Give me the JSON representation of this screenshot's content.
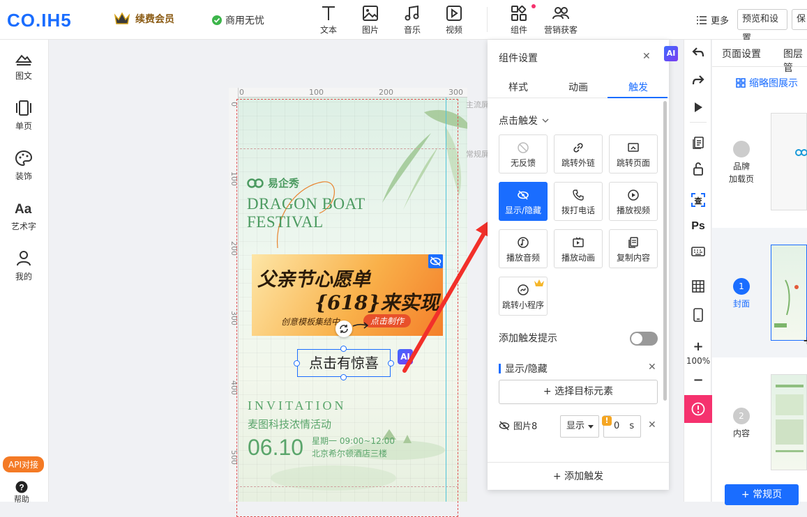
{
  "topbar": {
    "logo": "CO.IH5",
    "vip_label": "续费会员",
    "commerce_label": "商用无忧",
    "tools": [
      {
        "label": "文本",
        "icon": "text-icon"
      },
      {
        "label": "图片",
        "icon": "image-icon"
      },
      {
        "label": "音乐",
        "icon": "music-icon"
      },
      {
        "label": "视频",
        "icon": "video-icon"
      },
      {
        "label": "组件",
        "icon": "component-icon"
      },
      {
        "label": "营销获客",
        "icon": "users-icon"
      }
    ],
    "more": "更多",
    "preview": "预览和设置",
    "save": "保"
  },
  "sidebar": {
    "items": [
      {
        "label": "图文",
        "icon": "image-text-icon"
      },
      {
        "label": "单页",
        "icon": "single-page-icon"
      },
      {
        "label": "装饰",
        "icon": "palette-icon"
      },
      {
        "label": "艺术字",
        "icon": "art-text-icon"
      },
      {
        "label": "我的",
        "icon": "user-icon"
      }
    ],
    "api_label": "API对接",
    "help_label": "帮助"
  },
  "canvas": {
    "ruler_h": [
      "0",
      "100",
      "200",
      "300"
    ],
    "ruler_v": [
      "0",
      "100",
      "200",
      "300",
      "400",
      "500"
    ],
    "side_labels": [
      "主流屏",
      "常规屏"
    ],
    "brand": "易企秀",
    "dragon_line1": "DRAGON BOAT",
    "dragon_line2": "FESTIVAL",
    "banner_line1": "父亲节心愿单",
    "banner_line2": "{618}来实现",
    "banner_sub": "创意模板集结中",
    "banner_btn": "点击制作",
    "selected_text": "点击有惊喜",
    "ai_badge": "AI",
    "invitation": "INVITATION",
    "event": "麦图科技浓情活动",
    "date": "06.10",
    "time": "星期一  09:00~12:00",
    "venue": "北京希尔顿酒店三楼"
  },
  "panel": {
    "title": "组件设置",
    "tabs": [
      {
        "label": "样式"
      },
      {
        "label": "动画"
      },
      {
        "label": "触发"
      }
    ],
    "active_tab": "触发",
    "click_trigger": "点击触发",
    "actions": [
      {
        "label": "无反馈",
        "icon": "ban-icon"
      },
      {
        "label": "跳转外链",
        "icon": "link-icon"
      },
      {
        "label": "跳转页面",
        "icon": "page-jump-icon"
      },
      {
        "label": "显示/隐藏",
        "icon": "eye-icon",
        "active": true
      },
      {
        "label": "拨打电话",
        "icon": "phone-icon"
      },
      {
        "label": "播放视频",
        "icon": "play-icon"
      },
      {
        "label": "播放音频",
        "icon": "audio-icon"
      },
      {
        "label": "播放动画",
        "icon": "animation-icon"
      },
      {
        "label": "复制内容",
        "icon": "copy-icon"
      },
      {
        "label": "跳转小程序",
        "icon": "miniprogram-icon"
      }
    ],
    "add_hint": "添加触发提示",
    "hint_on": false,
    "section": "显示/隐藏",
    "select_target": "选择目标元素",
    "target_name": "图片8",
    "target_mode": "显示",
    "delay_value": "0",
    "delay_unit": "s",
    "add_trigger": "添加触发"
  },
  "righttools": {
    "zoom": "100%",
    "ai_badge": "AI"
  },
  "pages": {
    "tab_page": "页面设置",
    "tab_layer": "图层管",
    "thumb_view": "缩略图展示",
    "items": [
      {
        "name": "品牌\n加载页",
        "num": ""
      },
      {
        "name": "封面",
        "num": "1"
      },
      {
        "name": "内容",
        "num": "2"
      }
    ],
    "add_page": "+ 常规页"
  },
  "colors": {
    "accent": "#1a6dff",
    "alert": "#f5326e",
    "api": "#f47a25",
    "canvas_text": "#5aa56b"
  }
}
